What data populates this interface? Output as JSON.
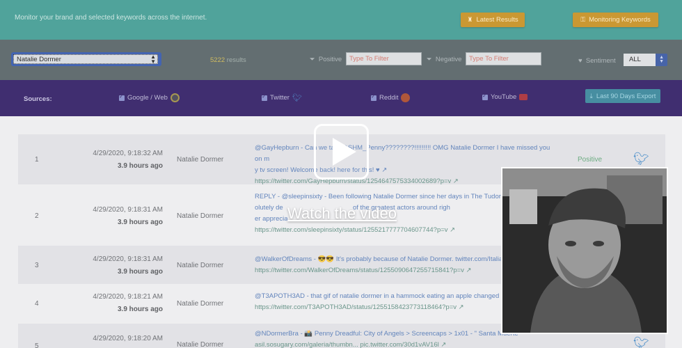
{
  "header": {
    "tagline": "Monitor your brand and selected keywords across the internet.",
    "latest_results_label": "Latest Results",
    "monitoring_keywords_label": "Monitoring Keywords"
  },
  "filters": {
    "keyword_value": "Natalie Dormer",
    "results_count": "5222",
    "results_label": "results",
    "positive_label": "Positive",
    "positive_placeholder": "Type To Filter",
    "negative_label": "Negative",
    "negative_placeholder": "Type To Filter",
    "sentiment_label": "Sentiment",
    "sentiment_value": "ALL"
  },
  "sources": {
    "title": "Sources:",
    "items": [
      {
        "label": "Google / Web"
      },
      {
        "label": "Twitter"
      },
      {
        "label": "Reddit"
      },
      {
        "label": "YouTube"
      }
    ],
    "export_label": "Last 90 Days Export"
  },
  "rows": [
    {
      "index": "1",
      "date": "4/29/2020, 9:18:32 AM",
      "ago": "3.9 hours ago",
      "name": "Natalie Dormer",
      "line1": "@GayHepburn - Can we talk @SHM_Penny????????!!!!!!!!! OMG Natalie Dormer I have missed you on m",
      "line2": "y tv screen! Welcome back! here for this! ♥ ↗",
      "url": "https://twitter.com/GayHepburn/status/1254647575334002689?p=v ↗",
      "sentiment": "Positive"
    },
    {
      "index": "2",
      "date": "4/29/2020, 9:18:31 AM",
      "ago": "3.9 hours ago",
      "name": "Natalie Dormer",
      "line1": "REPLY - @sleepinsixty - Been following Natalie Dormer since her days in The Tudors whe",
      "line2": "olutely de                                      of the greatest actors around righ",
      "line3": "er apprecia                  ",
      "url": "https://twitter.com/sleepinsixty/status/1255217777704607744?p=v ↗",
      "sentiment": ""
    },
    {
      "index": "3",
      "date": "4/29/2020, 9:18:31 AM",
      "ago": "3.9 hours ago",
      "name": "Natalie Dormer",
      "line1": "@WalkerOfDreams - 😎😎 It's probably because of Natalie Dormer. twitter.com/ItaliaT",
      "url": "https://twitter.com/WalkerOfDreams/status/1255090647255715841?p=v ↗",
      "sentiment": ""
    },
    {
      "index": "4",
      "date": "4/29/2020, 9:18:21 AM",
      "ago": "3.9 hours ago",
      "name": "Natalie Dormer",
      "line1": "@T3APOTH3AD - that gif of natalie dormer in a hammock eating an apple changed my li",
      "url": "https://twitter.com/T3APOTH3AD/status/1255158423773118464?p=v ↗",
      "sentiment": ""
    },
    {
      "index": "5",
      "date": "4/29/2020, 9:18:20 AM",
      "ago": "",
      "name": "Natalie Dormer",
      "line1": "@NDormerBra - 📸 Penny Dreadful: City of Angels > Screencaps > 1x01 - \" Santa Muerte",
      "line2": "asil.sosugary.com/galeria/thumbn... pic.twitter.com/30d1vAV16l ↗",
      "sentiment": ""
    }
  ],
  "video": {
    "watch_label": "Watch the video"
  },
  "colors": {
    "header_bg": "#38978e",
    "filter_bg": "#4e5a5e",
    "sources_bg": "#26125d",
    "button_orange": "#c38a17",
    "export_teal": "#2e7f95"
  }
}
